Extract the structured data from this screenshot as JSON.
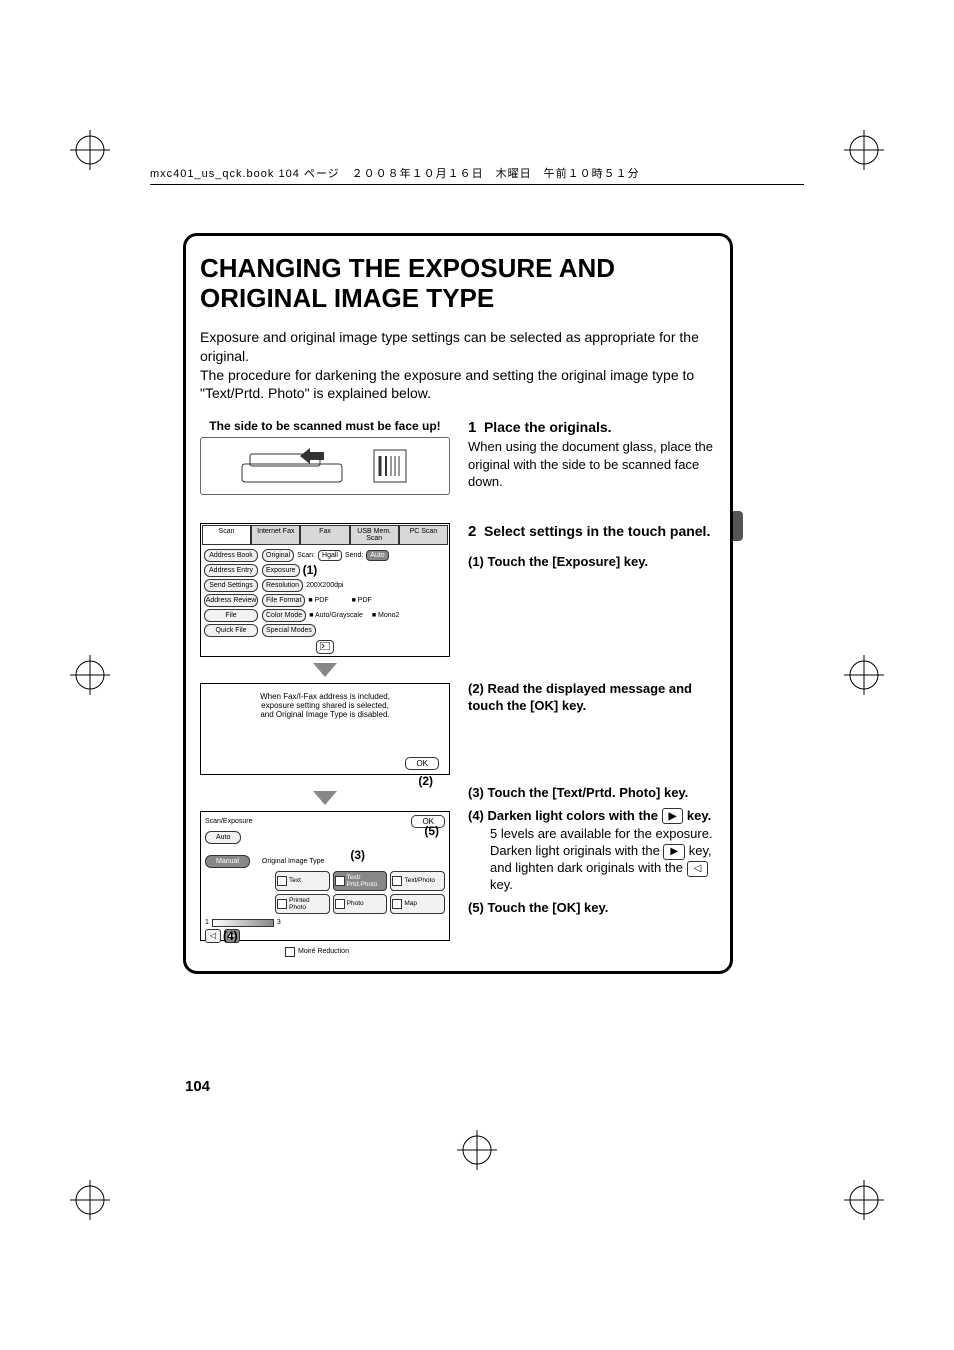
{
  "header_strip": "mxc401_us_qck.book  104 ページ　２００８年１０月１６日　木曜日　午前１０時５１分",
  "page_title": "CHANGING THE EXPOSURE AND ORIGINAL IMAGE TYPE",
  "intro_line1": "Exposure and original image type settings can be selected as appropriate for the original.",
  "intro_line2": "The procedure for darkening the exposure and setting the original image type to \"Text/Prtd. Photo\" is explained below.",
  "face_up_caption": "The side to be scanned must be face up!",
  "step1": {
    "num": "1",
    "title": "Place the originals.",
    "body": "When using the document glass, place the original with the side to be scanned face down."
  },
  "step2": {
    "num": "2",
    "title": "Select settings in the touch panel.",
    "sub1": {
      "num": "(1)",
      "text": "Touch the [Exposure] key."
    },
    "sub2": {
      "num": "(2)",
      "text": "Read the displayed message and touch the [OK] key."
    },
    "sub3": {
      "num": "(3)",
      "text": "Touch the [Text/Prtd. Photo] key."
    },
    "sub4": {
      "num": "(4)",
      "lead": "Darken light colors with the ",
      "tail": " key.",
      "body_a": "5 levels are available for the exposure. Darken light originals with the ",
      "body_b": " key, and lighten dark originals with the ",
      "body_c": " key."
    },
    "sub5": {
      "num": "(5)",
      "text": "Touch the [OK] key."
    }
  },
  "panel1": {
    "tabs": [
      "Scan",
      "Internet Fax",
      "Fax",
      "USB Mem. Scan",
      "PC Scan"
    ],
    "left_btns": [
      "Address Book",
      "Address Entry",
      "Send Settings",
      "Address Review",
      "File",
      "Quick File"
    ],
    "rows": [
      {
        "lbl": "Original",
        "val": "Scan:",
        "extra": "Send:"
      },
      {
        "lbl": "Exposure",
        "val": ""
      },
      {
        "lbl": "Resolution",
        "val": "200X200dpi"
      },
      {
        "lbl": "File Format",
        "val": "PDF",
        "extra": "PDF"
      },
      {
        "lbl": "Color Mode",
        "val": "Auto/Grayscale",
        "extra": "Mono2"
      },
      {
        "lbl": "Special Modes",
        "val": ""
      }
    ],
    "top_right": [
      "Hgall",
      "Auto"
    ],
    "marker": "(1)"
  },
  "msg_panel": {
    "line1": "When Fax/I-Fax address is included,",
    "line2": "exposure setting shared is selected,",
    "line3": "and Original Image Type is disabled.",
    "ok": "OK",
    "marker": "(2)"
  },
  "panel3": {
    "title": "Scan/Exposure",
    "ok": "OK",
    "auto": "Auto",
    "manual": "Manual",
    "orig_type_label": "Original Image Type",
    "types": [
      "Text",
      "Text/\nPrtd.Photo",
      "Text/Photo",
      "Printed\nPhoto",
      "Photo",
      "Map"
    ],
    "slider_from": "1",
    "slider_to": "3",
    "moire": "Moiré Reduction",
    "marker3": "(3)",
    "marker4": "(4)",
    "marker5": "(5)"
  },
  "page_number": "104"
}
